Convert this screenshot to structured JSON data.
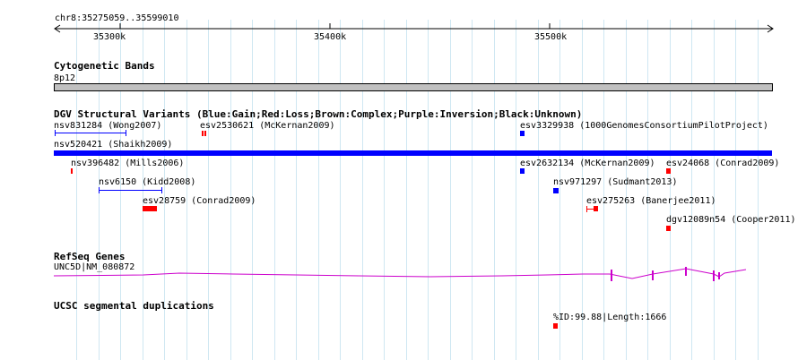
{
  "ruler": {
    "range_label": "chr8:35275059..35599010",
    "ticks": [
      "35300k",
      "35400k",
      "35500k"
    ]
  },
  "tracks": {
    "cyto": {
      "title": "Cytogenetic Bands",
      "band": "8p12",
      "band_color": "#c0c0c0"
    },
    "dgv": {
      "title": "DGV Structural Variants (Blue:Gain;Red:Loss;Brown:Complex;Purple:Inversion;Black:Unknown)",
      "colors": {
        "gain": "#0000ff",
        "loss": "#ff0000"
      },
      "features": [
        {
          "label": "nsv831284 (Wong2007)",
          "type": "gain"
        },
        {
          "label": "esv2530621 (McKernan2009)",
          "type": "loss"
        },
        {
          "label": "esv3329938 (1000GenomesConsortiumPilotProject)",
          "type": "gain"
        },
        {
          "label": "nsv520421 (Shaikh2009)",
          "type": "gain"
        },
        {
          "label": "nsv396482 (Mills2006)",
          "type": "loss"
        },
        {
          "label": "esv2632134 (McKernan2009)",
          "type": "gain"
        },
        {
          "label": "esv24068 (Conrad2009)",
          "type": "loss"
        },
        {
          "label": "nsv6150 (Kidd2008)",
          "type": "gain"
        },
        {
          "label": "nsv971297 (Sudmant2013)",
          "type": "gain"
        },
        {
          "label": "esv28759 (Conrad2009)",
          "type": "loss"
        },
        {
          "label": "esv275263 (Banerjee2011)",
          "type": "loss"
        },
        {
          "label": "dgv12089n54 (Cooper2011)",
          "type": "loss"
        }
      ]
    },
    "refseq": {
      "title": "RefSeq Genes",
      "gene": "UNC5D|NM_080872",
      "color": "#cc00cc"
    },
    "segdup": {
      "title": "UCSC segmental duplications",
      "feature": "%ID:99.88|Length:1666",
      "color": "#ff0000"
    }
  }
}
